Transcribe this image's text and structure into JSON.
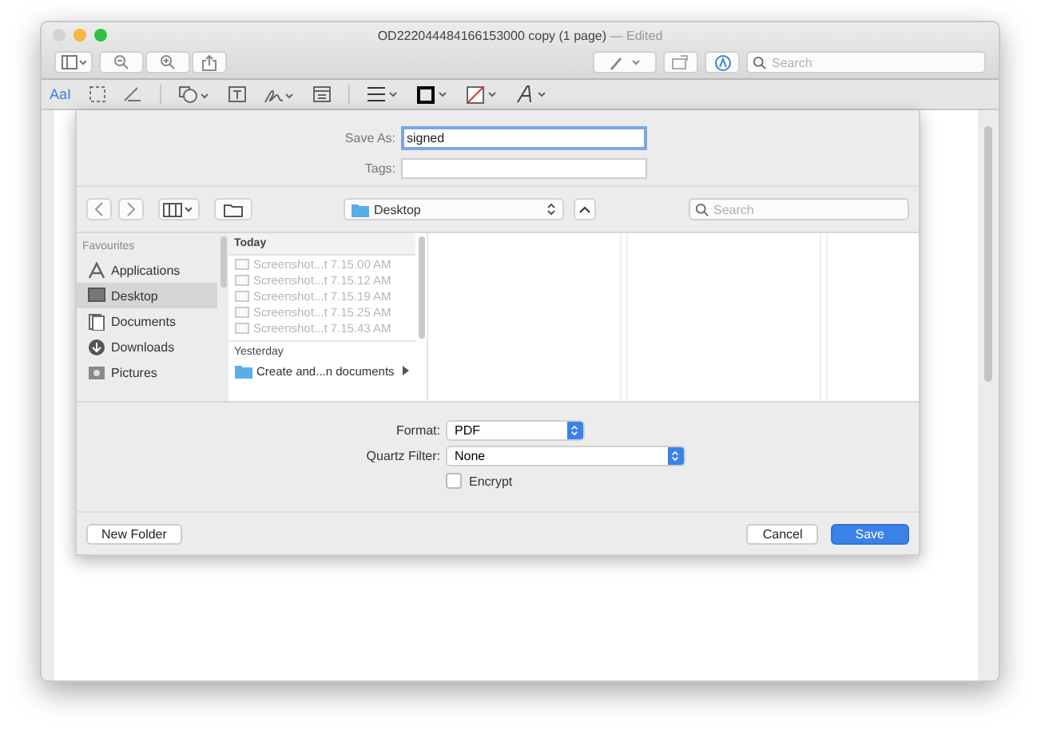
{
  "window": {
    "title": "OD222044484166153000 copy (1 page)",
    "status": "— Edited"
  },
  "toolbar": {
    "search": {
      "placeholder": "Search"
    }
  },
  "markup_bar": {
    "text_style": "AaI"
  },
  "save_dialog": {
    "save_as": {
      "label": "Save As:",
      "value": "signed"
    },
    "tags": {
      "label": "Tags:"
    },
    "location": "Desktop",
    "search": {
      "placeholder": "Search"
    },
    "sidebar": {
      "heading": "Favourites",
      "items": [
        {
          "label": "Applications",
          "kind": "apps",
          "selected": false
        },
        {
          "label": "Desktop",
          "kind": "desktop",
          "selected": true
        },
        {
          "label": "Documents",
          "kind": "documents",
          "selected": false
        },
        {
          "label": "Downloads",
          "kind": "downloads",
          "selected": false
        },
        {
          "label": "Pictures",
          "kind": "pictures",
          "selected": false
        }
      ]
    },
    "groups": [
      {
        "heading": "Today",
        "items": [
          {
            "name": "Screenshot...t 7.15.00 AM",
            "kind": "file",
            "disabled": true
          },
          {
            "name": "Screenshot...t 7.15.12 AM",
            "kind": "file",
            "disabled": true
          },
          {
            "name": "Screenshot...t 7.15.19 AM",
            "kind": "file",
            "disabled": true
          },
          {
            "name": "Screenshot...t 7.15.25 AM",
            "kind": "file",
            "disabled": true
          },
          {
            "name": "Screenshot...t 7.15.43 AM",
            "kind": "file",
            "disabled": true
          }
        ]
      },
      {
        "heading": "Yesterday",
        "items": [
          {
            "name": "Create and...n documents",
            "kind": "folder",
            "disabled": false
          }
        ]
      }
    ],
    "format": {
      "label": "Format:",
      "value": "PDF"
    },
    "quartz_filter": {
      "label": "Quartz Filter:",
      "value": "None"
    },
    "encrypt": {
      "label": "Encrypt",
      "checked": false
    },
    "buttons": [
      {
        "label": "New Folder",
        "kind": "plain"
      },
      {
        "label": "Cancel",
        "kind": "plain"
      },
      {
        "label": "Save",
        "kind": "default"
      }
    ]
  }
}
